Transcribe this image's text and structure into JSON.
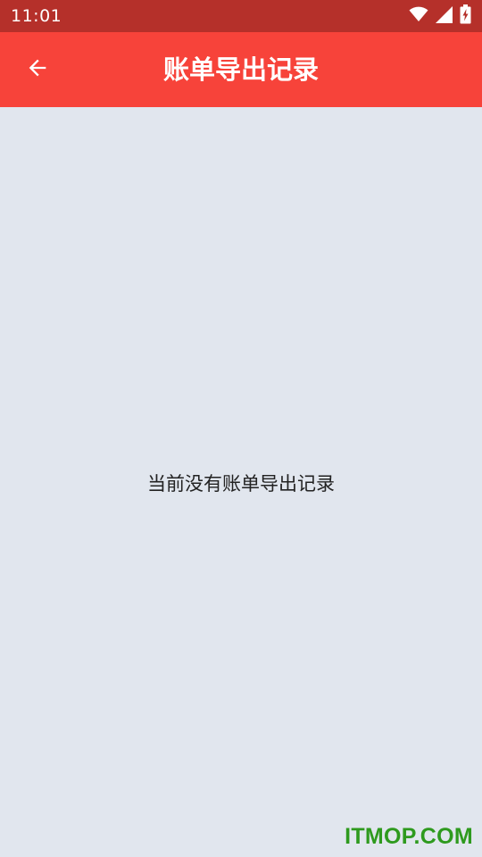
{
  "status_bar": {
    "time": "11:01",
    "icons": [
      "wifi-icon",
      "signal-icon",
      "battery-charging-icon"
    ]
  },
  "app_bar": {
    "back_icon": "arrow-left-icon",
    "title": "账单导出记录"
  },
  "content": {
    "empty_message": "当前没有账单导出记录"
  },
  "watermark": {
    "text": "ITMOP.COM"
  },
  "colors": {
    "status_bar": "#b5302a",
    "app_bar": "#f7433a",
    "background": "#e1e6ee",
    "watermark": "#2e9a1e"
  }
}
